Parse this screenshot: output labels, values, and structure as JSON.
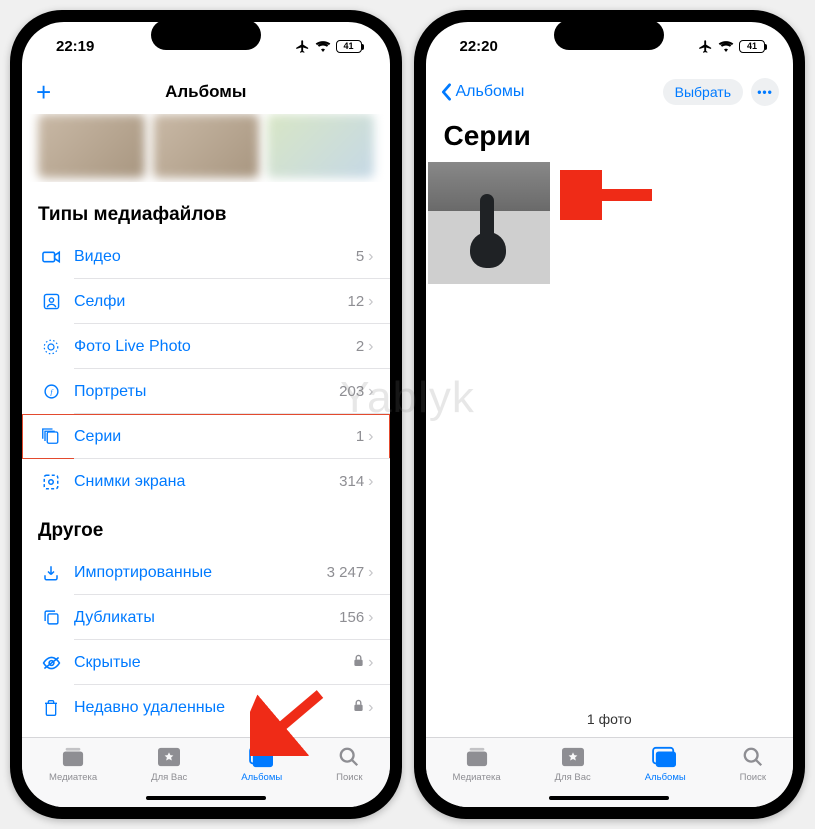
{
  "watermark": "Yablyk",
  "phone1": {
    "time": "22:19",
    "battery": "41",
    "nav_title": "Альбомы",
    "add_symbol": "+",
    "section_media": "Типы медиафайлов",
    "section_other": "Другое",
    "media_rows": [
      {
        "icon": "video",
        "label": "Видео",
        "count": "5"
      },
      {
        "icon": "selfie",
        "label": "Селфи",
        "count": "12"
      },
      {
        "icon": "live",
        "label": "Фото Live Photo",
        "count": "2"
      },
      {
        "icon": "portrait",
        "label": "Портреты",
        "count": "203"
      },
      {
        "icon": "burst",
        "label": "Серии",
        "count": "1"
      },
      {
        "icon": "screenshot",
        "label": "Снимки экрана",
        "count": "314"
      }
    ],
    "other_rows": [
      {
        "icon": "import",
        "label": "Импортированные",
        "count": "3 247"
      },
      {
        "icon": "dup",
        "label": "Дубликаты",
        "count": "156"
      },
      {
        "icon": "hidden",
        "label": "Скрытые",
        "locked": true
      },
      {
        "icon": "trash",
        "label": "Недавно удаленные",
        "locked": true
      }
    ],
    "tabs": [
      {
        "label": "Медиатека"
      },
      {
        "label": "Для Вас"
      },
      {
        "label": "Альбомы",
        "active": true
      },
      {
        "label": "Поиск"
      }
    ]
  },
  "phone2": {
    "time": "22:20",
    "battery": "41",
    "back_label": "Альбомы",
    "select_label": "Выбрать",
    "more_symbol": "•••",
    "title": "Серии",
    "footer": "1 фото",
    "tabs": [
      {
        "label": "Медиатека"
      },
      {
        "label": "Для Вас"
      },
      {
        "label": "Альбомы",
        "active": true
      },
      {
        "label": "Поиск"
      }
    ]
  }
}
